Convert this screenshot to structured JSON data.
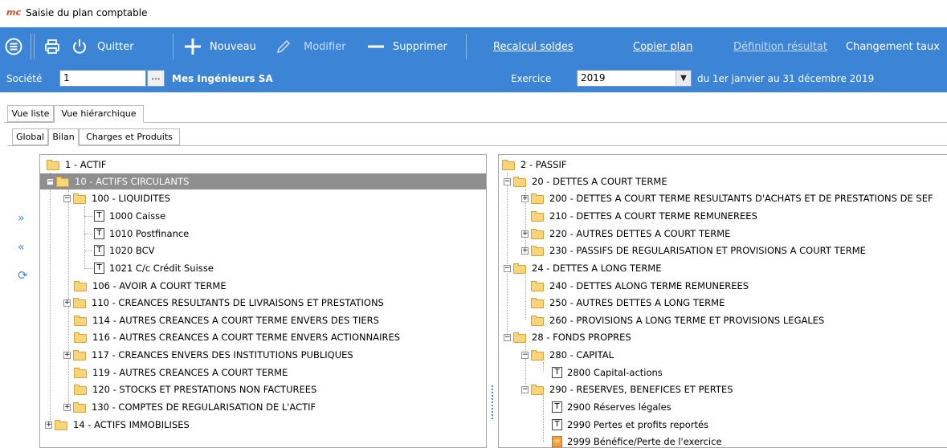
{
  "window": {
    "logo_text": "mc",
    "title": "Saisie du plan comptable"
  },
  "toolbar": {
    "quit": "Quitter",
    "new": "Nouveau",
    "edit": "Modifier",
    "delete": "Supprimer",
    "recalc": "Recalcul soldes",
    "copy_plan": "Copier plan",
    "result_def": "Définition résultat",
    "change_rate": "Changement taux"
  },
  "infobar": {
    "company_label": "Société",
    "company_value": "1",
    "browse": "...",
    "company_name": "Mes Ingénieurs SA",
    "year_label": "Exercice",
    "year_value": "2019",
    "period": "du 1er janvier au 31 décembre 2019"
  },
  "view_tabs": [
    "Vue liste",
    "Vue hiérarchique"
  ],
  "sub_tabs": [
    "Global",
    "Bilan",
    "Charges et Produits"
  ],
  "left_tree": [
    "1 - ACTIF",
    "10 - ACTIFS CIRCULANTS",
    "100 - LIQUIDITES",
    "1000  Caisse",
    "1010  Postfinance",
    "1020  BCV",
    "1021  C/c Crédit Suisse",
    "106 - AVOIR A COURT TERME",
    "110 - CREANCES RESULTANTS DE LIVRAISONS ET PRESTATIONS",
    "114 - AUTRES CREANCES A COURT TERME ENVERS DES TIERS",
    "116 - AUTRES CREANCES A COURT TERME ENVERS ACTIONNAIRES",
    "117 - CREANCES ENVERS DES INSTITUTIONS PUBLIQUES",
    "119 - AUTRES CREANCES A COURT TERME",
    "120 - STOCKS ET PRESTATIONS NON FACTUREES",
    "130 - COMPTES DE REGULARISATION DE L'ACTIF",
    "14 - ACTIFS IMMOBILISES"
  ],
  "right_tree": [
    "2 - PASSIF",
    "20 - DETTES A COURT TERME",
    "200 - DETTES A COURT TERME RESULTANTS D'ACHATS ET DE PRESTATIONS DE SEF",
    "210 - DETTES A COURT TERME REMUNEREES",
    "220 - AUTRES DETTES A COURT TERME",
    "230 - PASSIFS DE REGULARISATION ET PROVISIONS A COURT TERME",
    "24 - DETTES A LONG TERME",
    "240 - DETTES ALONG TERME REMUNEREES",
    "250 - AUTRES DETTES A LONG TERME",
    "260 - PROVISIONS A LONG TERME ET PROVISIONS LEGALES",
    "28 - FONDS PROPRES",
    "280 - CAPITAL",
    "2800  Capital-actions",
    "290 - RESERVES, BENEFICES ET PERTES",
    "2900  Réserves légales",
    "2990  Pertes et profits reportés",
    "2999  Bénéfice/Perte de l'exercice"
  ],
  "colors": {
    "toolbar_bg": "#3c84d6",
    "selection_bg": "#8f8f8f",
    "folder": "#f8d47a"
  }
}
